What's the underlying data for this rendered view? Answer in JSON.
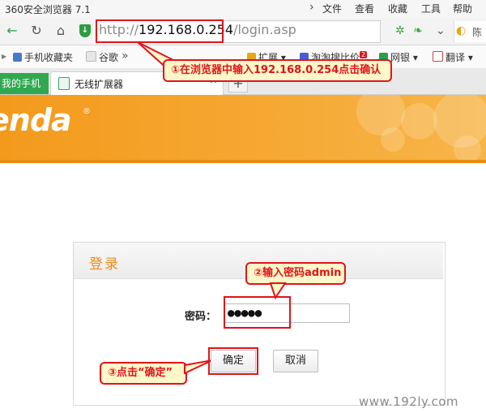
{
  "window": {
    "title": "360安全浏览器 7.1",
    "menu": [
      "文件",
      "查看",
      "收藏",
      "工具",
      "帮助"
    ]
  },
  "address_bar": {
    "scheme": "http://",
    "host": "192.168.0.254",
    "path": "/login.asp",
    "search_hint": "陈"
  },
  "bookmarks": [
    {
      "label": "手机收藏夹",
      "color": "#4a78c8"
    },
    {
      "label": "谷歌",
      "color": "#bbbbbb"
    },
    {
      "label": "»",
      "color": ""
    },
    {
      "label": "扩展",
      "color": "#e9a516"
    },
    {
      "label": "淘淘搜比价",
      "color": "#4c5bd4",
      "badge": "2"
    },
    {
      "label": "网银",
      "color": "#2c9c4a"
    },
    {
      "label": "翻译",
      "color": "#d64040"
    }
  ],
  "tabs": [
    {
      "label": "我的手机"
    },
    {
      "label": "无线扩展器"
    }
  ],
  "brand": {
    "logo_text": "enda",
    "logo_mark": "®",
    "accent": "#f39a1c"
  },
  "login": {
    "title": "登录",
    "password_label": "密码：",
    "password_value": "●●●●●",
    "ok_label": "确定",
    "cancel_label": "取消"
  },
  "annotations": {
    "step1": "①在浏览器中输入192.168.0.254点击确认",
    "step2": "②输入密码admin",
    "step3": "③点击“确定”"
  },
  "watermark": "www.192ly.com"
}
